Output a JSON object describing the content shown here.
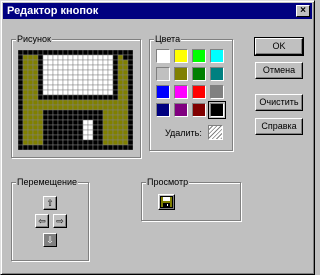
{
  "window": {
    "title": "Редактор кнопок",
    "close_glyph": "×"
  },
  "picture": {
    "label": "Рисунок",
    "rows": [
      "XXXXXXXXXXXXXXXXXXXXXXX",
      "XGGGXWWWWWWWWWWWWWWXGXX",
      "XGGGXWWWWWWWWWWWWWWXGGX",
      "XGGGXWWWWWWWWWWWWWWXGGX",
      "XGGGXWWWWWWWWWWWWWWXGGX",
      "XGGGXWWWWWWWWWWWWWWXGGX",
      "XGGGXWWWWWWWWWWWWWWXGGX",
      "XGGGXWWWWWWWWWWWWWWXGGX",
      "XGGGXWWWWWWWWWWWWWWXGGX",
      "XGGGXXXXXXXXXXXXXXXXGGX",
      "XGGGGGGGGGGGGGGGGGGGGGX",
      "XGGGGGGGGGGGGGGGGGGGGGX",
      "XGGGGXXXXXXXXXXXXGGGGGX",
      "XGGGGXXXXXXXXXXXXGGGGGX",
      "XGGGGXXXXXXXXWWXXGGGGGX",
      "XGGGGXXXXXXXXWWXXGGGGGX",
      "XGGGGXXXXXXXXWWXXGGGGGX",
      "XGGGGXXXXXXXXWWXXGGGGGX",
      "XGGGGXXXXXXXXXXXXGGGGGX",
      "XXXXXXXXXXXXXXXXXXXXXXX"
    ],
    "palette": {
      "X": "#000000",
      "G": "#808000",
      "W": "#ffffff"
    }
  },
  "colors": {
    "label": "Цвета",
    "swatches": [
      "#ffffff",
      "#ffff00",
      "#00ff00",
      "#00ffff",
      "#c0c0c0",
      "#808000",
      "#008000",
      "#008080",
      "#0000ff",
      "#ff00ff",
      "#ff0000",
      "#808080",
      "#000080",
      "#800080",
      "#800000",
      "#000000"
    ],
    "selected_index": 15,
    "erase_label": "Удалить:"
  },
  "buttons": {
    "ok": "OK",
    "cancel": "Отмена",
    "clear": "Очистить",
    "help": "Справка"
  },
  "move": {
    "label": "Перемещение",
    "up": "⇧",
    "left": "⇦",
    "right": "⇨",
    "down": "⇩"
  },
  "preview": {
    "label": "Просмотр"
  }
}
